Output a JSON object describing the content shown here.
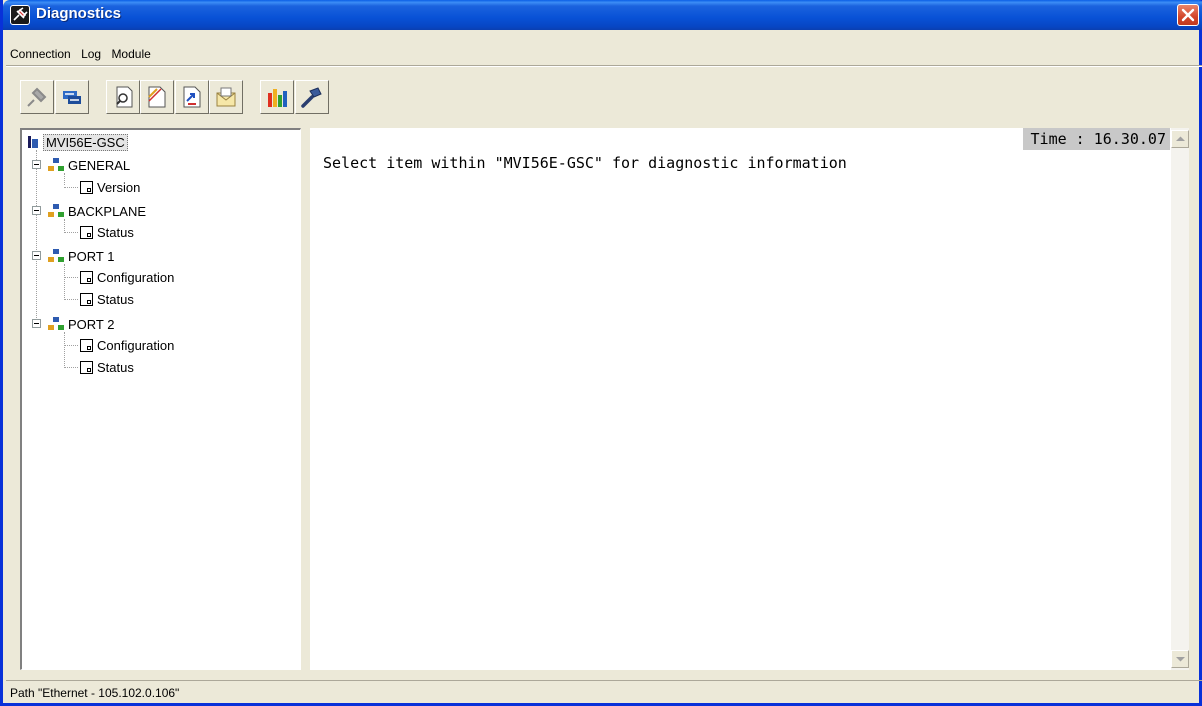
{
  "window": {
    "title": "Diagnostics",
    "app_icon": "plug-icon",
    "close_icon": "close-icon"
  },
  "menu": [
    "Connection",
    "Log",
    "Module"
  ],
  "toolbar": [
    {
      "icon": "disconnect-icon"
    },
    {
      "icon": "connect-icon"
    },
    {
      "icon": "find-icon"
    },
    {
      "icon": "new-log-icon"
    },
    {
      "icon": "send-log-icon"
    },
    {
      "icon": "email-log-icon"
    },
    {
      "icon": "chart-icon"
    },
    {
      "icon": "tool-icon"
    }
  ],
  "tree": {
    "root": "MVI56E-GSC",
    "groups": [
      {
        "label": "GENERAL",
        "items": [
          "Version"
        ]
      },
      {
        "label": "BACKPLANE",
        "items": [
          "Status"
        ]
      },
      {
        "label": "PORT 1",
        "items": [
          "Configuration",
          "Status"
        ]
      },
      {
        "label": "PORT 2",
        "items": [
          "Configuration",
          "Status"
        ]
      }
    ]
  },
  "content": {
    "message": "Select item within \"MVI56E-GSC\" for diagnostic information",
    "time": "Time : 16.30.07"
  },
  "status": {
    "path": "Path \"Ethernet - 105.102.0.106\""
  }
}
